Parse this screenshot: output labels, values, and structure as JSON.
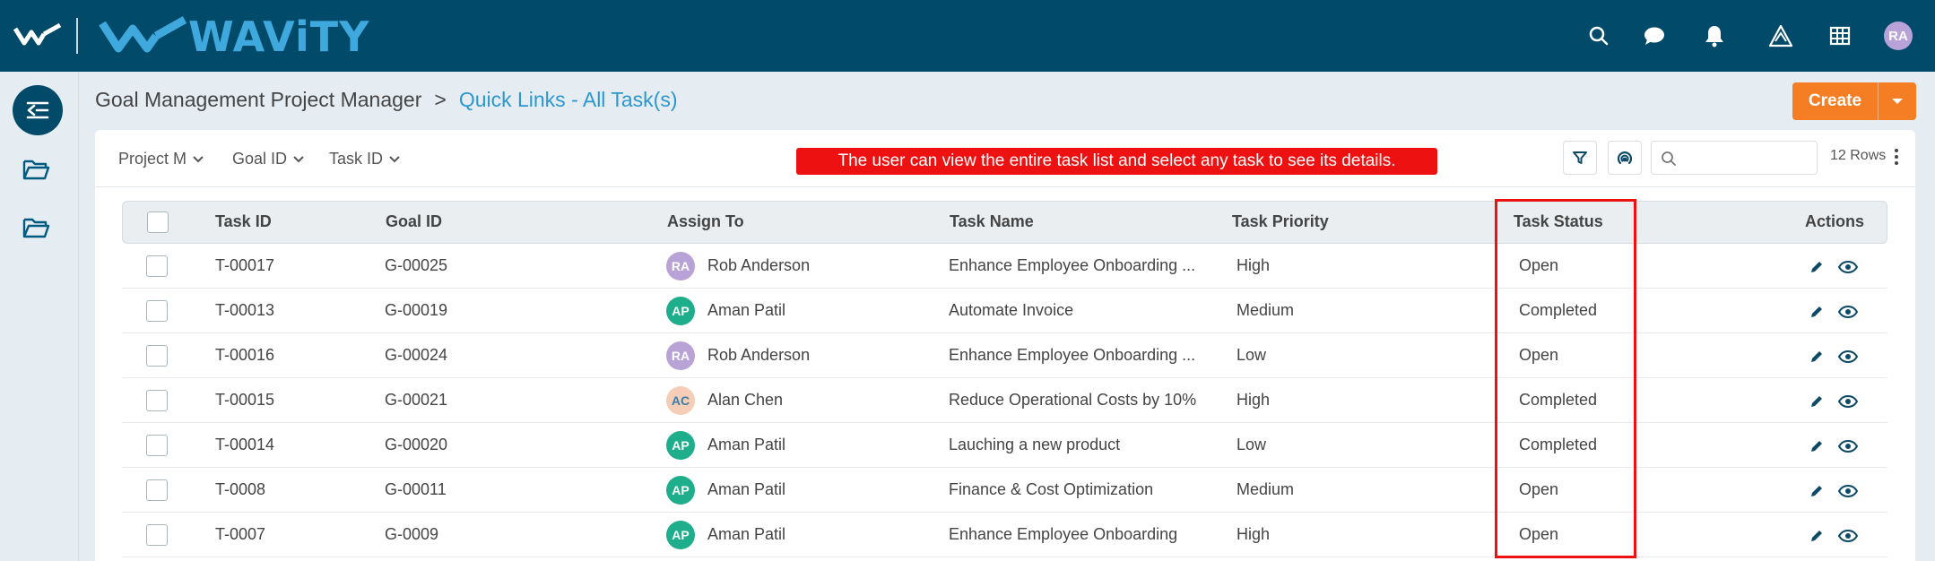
{
  "brand": {
    "name": "WAViTY"
  },
  "topbar": {
    "avatar": "RA"
  },
  "breadcrumb": {
    "root": "Goal Management Project Manager",
    "separator": ">",
    "current": "Quick Links - All Task(s)"
  },
  "create": {
    "label": "Create"
  },
  "filters": [
    {
      "label": "Project M"
    },
    {
      "label": "Goal ID"
    },
    {
      "label": "Task ID"
    }
  ],
  "banner": "The user can view the entire task list and select any task to see its details.",
  "search": {
    "placeholder": ""
  },
  "rows_label": "12 Rows",
  "columns": [
    "Task ID",
    "Goal ID",
    "Assign To",
    "Task Name",
    "Task Priority",
    "Task Status",
    "Actions"
  ],
  "rows": [
    {
      "task_id": "T-00017",
      "goal_id": "G-00025",
      "initials": "RA",
      "assignee": "Rob Anderson",
      "task_name": "Enhance Employee Onboarding ...",
      "priority": "High",
      "status": "Open"
    },
    {
      "task_id": "T-00013",
      "goal_id": "G-00019",
      "initials": "AP",
      "assignee": "Aman Patil",
      "task_name": "Automate Invoice",
      "priority": "Medium",
      "status": "Completed"
    },
    {
      "task_id": "T-00016",
      "goal_id": "G-00024",
      "initials": "RA",
      "assignee": "Rob Anderson",
      "task_name": "Enhance Employee Onboarding ...",
      "priority": "Low",
      "status": "Open"
    },
    {
      "task_id": "T-00015",
      "goal_id": "G-00021",
      "initials": "AC",
      "assignee": "Alan Chen",
      "task_name": "Reduce Operational Costs by 10%",
      "priority": "High",
      "status": "Completed"
    },
    {
      "task_id": "T-00014",
      "goal_id": "G-00020",
      "initials": "AP",
      "assignee": "Aman Patil",
      "task_name": "Lauching a new product",
      "priority": "Low",
      "status": "Completed"
    },
    {
      "task_id": "T-0008",
      "goal_id": "G-00011",
      "initials": "AP",
      "assignee": "Aman Patil",
      "task_name": "Finance & Cost Optimization",
      "priority": "Medium",
      "status": "Open"
    },
    {
      "task_id": "T-0007",
      "goal_id": "G-0009",
      "initials": "AP",
      "assignee": "Aman Patil",
      "task_name": "Enhance Employee Onboarding",
      "priority": "High",
      "status": "Open"
    }
  ],
  "avatar_colors": {
    "RA": "#b9a3d6",
    "AP": "#1fae8c",
    "AC": "#f6cdb7"
  },
  "avatar_text_colors": {
    "RA": "#ffffff",
    "AP": "#ffffff",
    "AC": "#3a7ea8"
  },
  "colors": {
    "topbar": "#014a6a",
    "accent": "#2b97cf",
    "create": "#f57d24",
    "banner": "#ee1111",
    "highlight": "#ee1111"
  }
}
